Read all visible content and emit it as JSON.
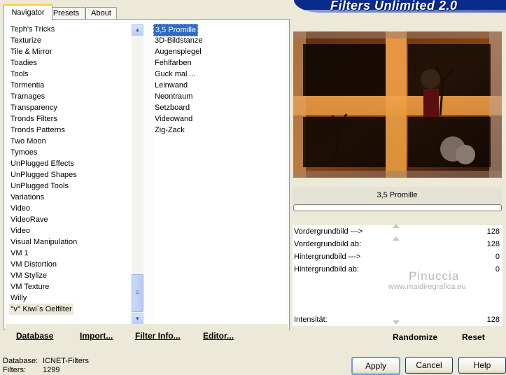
{
  "app": {
    "banner_title": "Filters Unlimited 2.0"
  },
  "tabs": [
    {
      "label": "Navigator"
    },
    {
      "label": "Presets"
    },
    {
      "label": "About"
    }
  ],
  "categories": [
    "Teph's Tricks",
    "Texturize",
    "Tile & Mirror",
    "Toadies",
    "Tools",
    "Tormentia",
    "Tramages",
    "Transparency",
    "Tronds Filters",
    "Tronds Patterns",
    "Two Moon",
    "Tymoes",
    "UnPlugged Effects",
    "UnPlugged Shapes",
    "UnPlugged Tools",
    "Variations",
    "Video",
    "VideoRave",
    "Video",
    "Visual Manipulation",
    "VM 1",
    "VM Distortion",
    "VM Stylize",
    "VM Texture",
    "Willy",
    "°v° Kiwi`s Oelfilter"
  ],
  "filters": [
    "3,5 Promille",
    "3D-Bildstanze",
    "Augenspiegel",
    "Fehlfarben",
    "Guck mal ...",
    "Leinwand",
    "Neontraum",
    "Setzboard",
    "Videowand",
    "Zig-Zack"
  ],
  "selected_filter_index": 0,
  "toolbar": {
    "database": "Database",
    "import": "Import...",
    "filter_info": "Filter Info...",
    "editor": "Editor..."
  },
  "preview": {
    "filter_name": "3,5 Promille",
    "progress": 0
  },
  "params": [
    {
      "label": "Vordergrundbild --->",
      "value": "128"
    },
    {
      "label": "Vordergrundbild ab:",
      "value": "128"
    },
    {
      "label": "Hintergrundbild --->",
      "value": "0"
    },
    {
      "label": "Hintergrundbild ab:",
      "value": "0"
    },
    {
      "label": "Intensität:",
      "value": "128"
    }
  ],
  "watermark": {
    "name": "Pinuccia",
    "url": "www.maidiregrafica.eu"
  },
  "actions": {
    "randomize": "Randomize",
    "reset": "Reset"
  },
  "status": {
    "database_label": "Database:",
    "database_value": "ICNET-Filters",
    "filters_label": "Filters:",
    "filters_value": "1299"
  },
  "dialog": {
    "apply": "Apply",
    "cancel": "Cancel",
    "help": "Help"
  },
  "colors": {
    "selection": "#316ac5",
    "banner": "#0a2a8c",
    "tab_highlight": "#ffc83c"
  }
}
